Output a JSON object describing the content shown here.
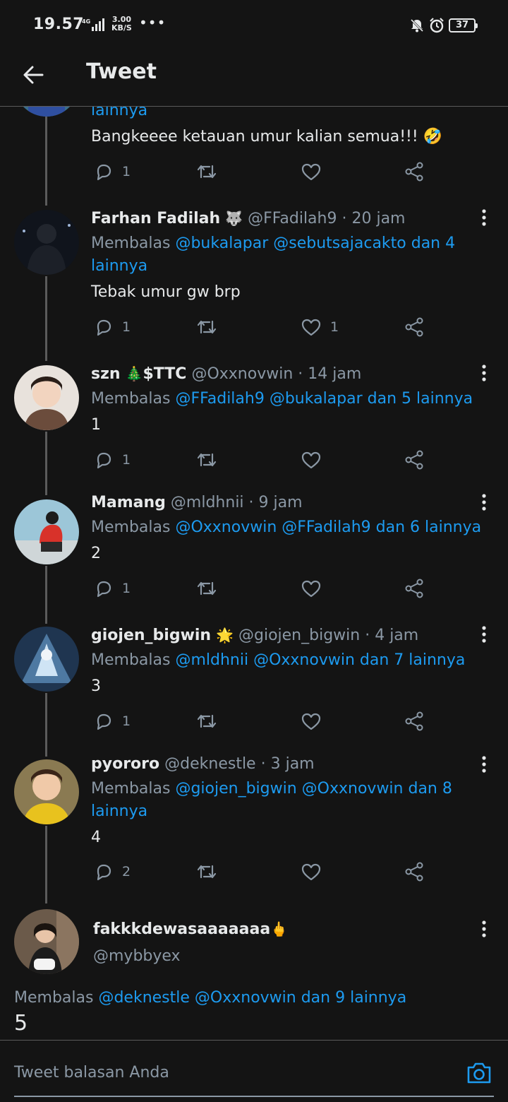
{
  "status_bar": {
    "time": "19.57",
    "network": "4G",
    "speed_value": "3.00",
    "speed_unit": "KB/S",
    "more": "•••",
    "battery": "37"
  },
  "header": {
    "title": "Tweet"
  },
  "replying_prefix": "Membalas",
  "tweets": [
    {
      "reply_tail": "lainnya",
      "text": "Bangkeeee ketauan umur kalian semua!!! 🤣",
      "replies": "1",
      "likes": ""
    },
    {
      "name": "Farhan Fadilah",
      "emoji": "🐺",
      "handle": "@FFadilah9",
      "time": "· 20 jam",
      "mentions": "@bukalapar @sebutsajacakto dan 4 lainnya",
      "text": "Tebak umur gw brp",
      "replies": "1",
      "likes": "1"
    },
    {
      "name": "szn",
      "emoji": "🎄",
      "name2": "$TTC",
      "handle": "@Oxxnovwin",
      "time": "· 14 jam",
      "mentions": "@FFadilah9 @bukalapar dan 5 lainnya",
      "text": "1",
      "replies": "1",
      "likes": ""
    },
    {
      "name": "Mamang",
      "handle": "@mldhnii",
      "time": "· 9 jam",
      "mentions": "@Oxxnovwin @FFadilah9 dan 6 lainnya",
      "text": "2",
      "replies": "1",
      "likes": ""
    },
    {
      "name": "giojen_bigwin",
      "emoji": "🌟",
      "handle": "@giojen_bigwin",
      "time": "· 4 jam",
      "mentions": "@mldhnii @Oxxnovwin dan 7 lainnya",
      "text": "3",
      "replies": "1",
      "likes": ""
    },
    {
      "name": "pyororo",
      "handle": "@deknestle",
      "time": "· 3 jam",
      "mentions": "@giojen_bigwin @Oxxnovwin dan 8 lainnya",
      "text": "4",
      "replies": "2",
      "likes": ""
    },
    {
      "name": "fakkkdewasaaaaaaa",
      "emoji": "🖕",
      "handle": "@mybbyex",
      "mentions": "@deknestle @Oxxnovwin dan 9 lainnya",
      "text": "5"
    }
  ],
  "reply_box": {
    "placeholder": "Tweet balasan Anda"
  },
  "colors": {
    "background": "#141414",
    "link": "#1d9bf0",
    "muted": "#8b98a5",
    "text": "#e7e9ea"
  },
  "icons": [
    "back-arrow-icon",
    "reply-icon",
    "retweet-icon",
    "like-icon",
    "share-icon",
    "more-icon",
    "camera-icon"
  ]
}
